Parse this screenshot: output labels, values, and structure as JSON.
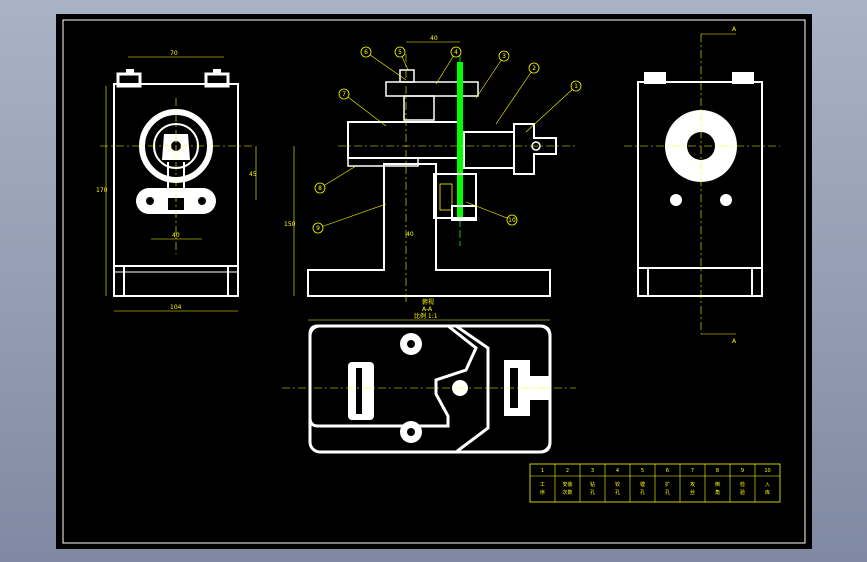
{
  "colors": {
    "line": "#ffffff",
    "dimension": "#ffff00",
    "highlight": "#00ff00",
    "background": "#000000"
  },
  "left_view": {
    "dim_top": "70",
    "dim_bottom": "104",
    "dim_inner": "40",
    "dim_left": "170",
    "dim_right": "45"
  },
  "center_view": {
    "dim_top": "40",
    "dim_height": "150",
    "dim_base": "40",
    "callouts": [
      "6",
      "5",
      "4",
      "3",
      "2",
      "1",
      "7",
      "8",
      "9",
      "10"
    ]
  },
  "right_view": {
    "section_top": "A",
    "section_bottom": "A"
  },
  "bottom_view": {
    "caption_1": "俯视",
    "caption_2": "A-A",
    "caption_3": "比例 1:1"
  },
  "title_block": {
    "numbers": [
      "1",
      "2",
      "3",
      "4",
      "5",
      "6",
      "7",
      "8",
      "9",
      "10"
    ],
    "labels": [
      "工序",
      "安装次数",
      "钻孔",
      "铰孔",
      "镗孔",
      "扩孔",
      "攻丝",
      "倒角",
      "检验",
      "入库"
    ]
  }
}
